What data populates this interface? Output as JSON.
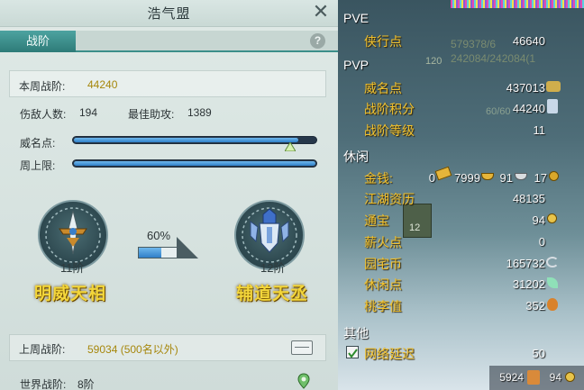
{
  "window": {
    "title": "浩气盟",
    "tab": "战阶",
    "help": "?",
    "close": "✕"
  },
  "rank": {
    "week_label": "本周战阶:",
    "week_value": "44240",
    "kills_label": "伤敌人数:",
    "kills_value": "194",
    "assist_label": "最佳助攻:",
    "assist_value": "1389",
    "prestige_label": "威名点:",
    "prestige_progress": 0.93,
    "weekly_cap_label": "周上限:",
    "weekly_cap_progress": 1.0,
    "current_rank": "11阶",
    "current_name": "明威天相",
    "next_rank": "12阶",
    "next_name": "辅道天丞",
    "progress_percent": "60%",
    "progress_value": 0.6,
    "last_week_label": "上周战阶:",
    "last_week_value": "59034 (500名以外)",
    "world_label": "世界战阶:",
    "world_value": "8阶"
  },
  "right": {
    "pve_header": "PVE",
    "pve_rows": [
      {
        "label": "侠行点",
        "value": "46640"
      }
    ],
    "pvp_header": "PVP",
    "pvp_rows": [
      {
        "label": "威名点",
        "value": "437013"
      },
      {
        "label": "战阶积分",
        "value": "44240"
      },
      {
        "label": "战阶等级",
        "value": "11"
      }
    ],
    "leisure_header": "休闲",
    "money": {
      "label": "金钱:",
      "gold_brick": "0",
      "gold": "7999",
      "silver": "91",
      "copper": "17"
    },
    "leisure_rows": [
      {
        "label": "江湖资历",
        "value": "48135"
      },
      {
        "label": "通宝",
        "value": "94"
      },
      {
        "label": "薪火点",
        "value": "0"
      },
      {
        "label": "园宅币",
        "value": "165732"
      },
      {
        "label": "休闲点",
        "value": "31202"
      },
      {
        "label": "桃李值",
        "value": "352"
      }
    ],
    "other_header": "其他",
    "network_label": "网络延迟",
    "network_value": "50",
    "bottom_left_value": "5924",
    "bottom_right_value": "94",
    "bg_text_1": "579378/6",
    "bg_text_2": "242084/242084(1",
    "bg_text_3": "120",
    "bg_text_4": "60/60",
    "bg_text_5": "12"
  },
  "colors": {
    "accent_teal": "#2e7b78",
    "gold_text": "#f2c22e",
    "bar_blue": "#2f7fc8"
  }
}
